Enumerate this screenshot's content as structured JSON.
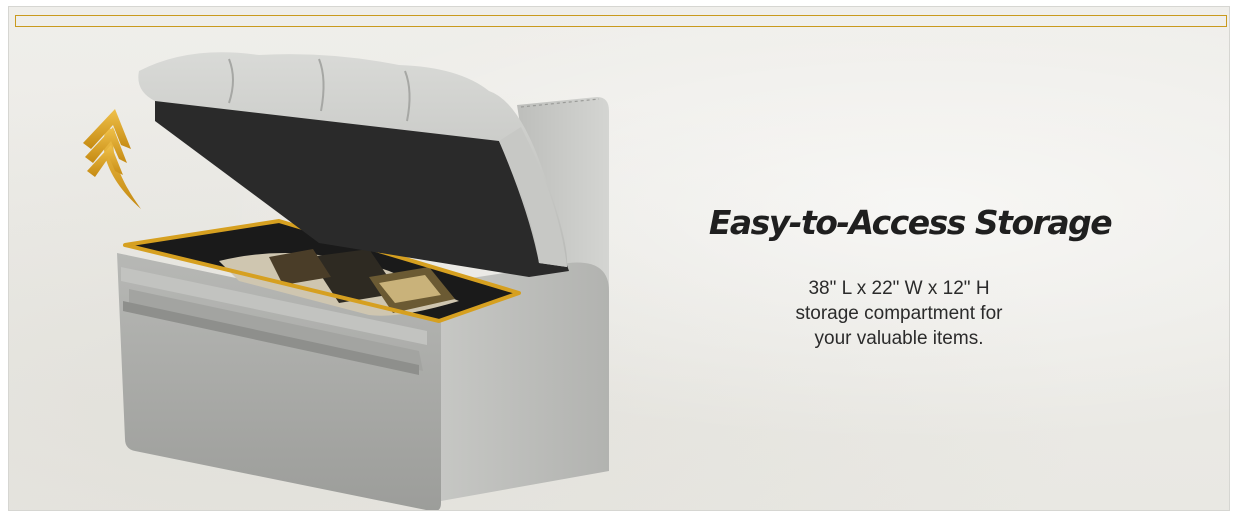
{
  "colors": {
    "accent_gold": "#c99a1e",
    "background": "#ecebe6",
    "bench_body": "#a9aaa7",
    "headline": "#1f1f1f"
  },
  "icons": {
    "arrow": "up-arrow-chevrons-icon"
  },
  "feature": {
    "headline": "Easy-to-Access Storage",
    "description_lines": [
      "38\" L x 22\" W x 12\" H",
      "storage compartment for",
      "your valuable items."
    ]
  }
}
